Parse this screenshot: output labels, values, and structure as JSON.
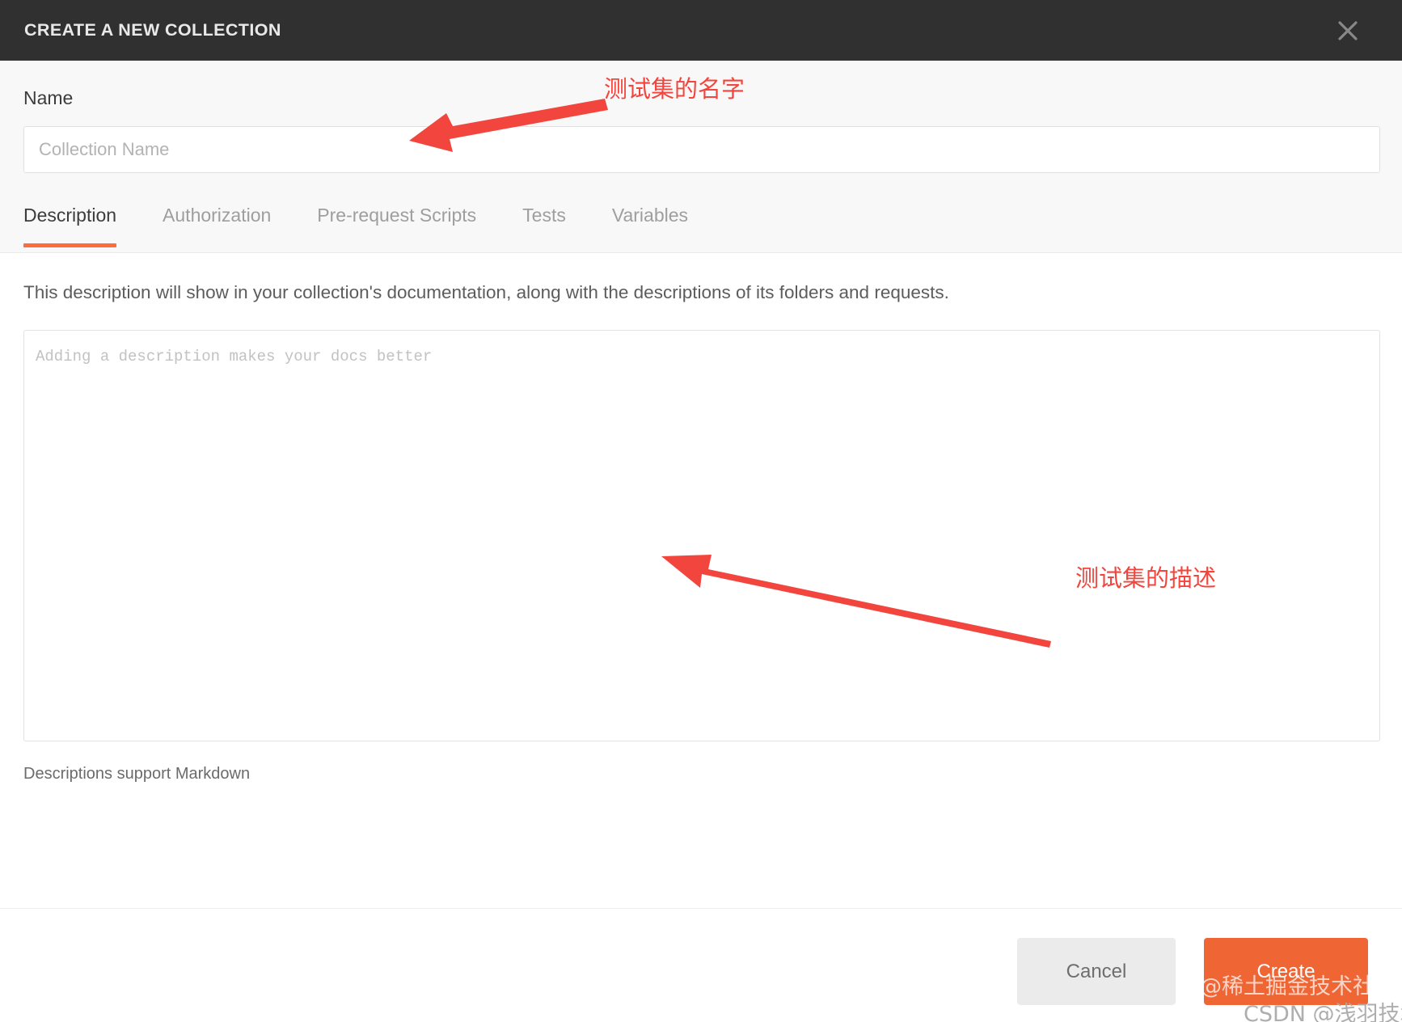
{
  "header": {
    "title": "CREATE A NEW COLLECTION",
    "close_icon": "close-icon"
  },
  "form": {
    "name_label": "Name",
    "name_value": "",
    "name_placeholder": "Collection Name"
  },
  "tabs": [
    {
      "label": "Description",
      "active": true
    },
    {
      "label": "Authorization",
      "active": false
    },
    {
      "label": "Pre-request Scripts",
      "active": false
    },
    {
      "label": "Tests",
      "active": false
    },
    {
      "label": "Variables",
      "active": false
    }
  ],
  "description_panel": {
    "helper_text": "This description will show in your collection's documentation, along with the descriptions of its folders and requests.",
    "textarea_value": "",
    "textarea_placeholder": "Adding a description makes your docs better",
    "markdown_note": "Descriptions support Markdown"
  },
  "footer": {
    "cancel_label": "Cancel",
    "create_label": "Create"
  },
  "annotations": [
    {
      "text": "测试集的名字",
      "target": "name-input"
    },
    {
      "text": "测试集的描述",
      "target": "description-textarea"
    }
  ],
  "watermarks": {
    "juejin": "@稀土掘金技术社区",
    "csdn": "CSDN @浅羽技术"
  },
  "colors": {
    "header_bg": "#303030",
    "accent_orange": "#ff6c37",
    "create_button": "#ef6533",
    "annotation_red": "#f2453d",
    "upper_bg": "#f8f8f8"
  }
}
